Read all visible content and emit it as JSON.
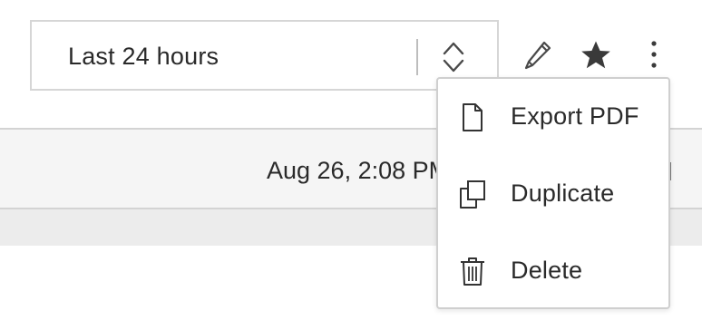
{
  "toolbar": {
    "time_range": {
      "selected": "Last 24 hours",
      "icon": "sort-updown-icon"
    },
    "actions": [
      {
        "name": "edit",
        "icon": "pencil-icon"
      },
      {
        "name": "favorite",
        "icon": "star-icon",
        "active": true
      },
      {
        "name": "more",
        "icon": "kebab-icon"
      }
    ]
  },
  "table": {
    "timestamp": "Aug 26, 2:08 PM"
  },
  "menu": {
    "items": [
      {
        "label": "Export PDF",
        "icon": "file-icon"
      },
      {
        "label": "Duplicate",
        "icon": "copy-icon"
      },
      {
        "label": "Delete",
        "icon": "trash-icon"
      }
    ]
  },
  "colors": {
    "border": "#d6d6d6",
    "text": "#2a2a2a",
    "header_bg": "#f5f5f5",
    "band_bg": "#ececec",
    "icon": "#333333"
  }
}
